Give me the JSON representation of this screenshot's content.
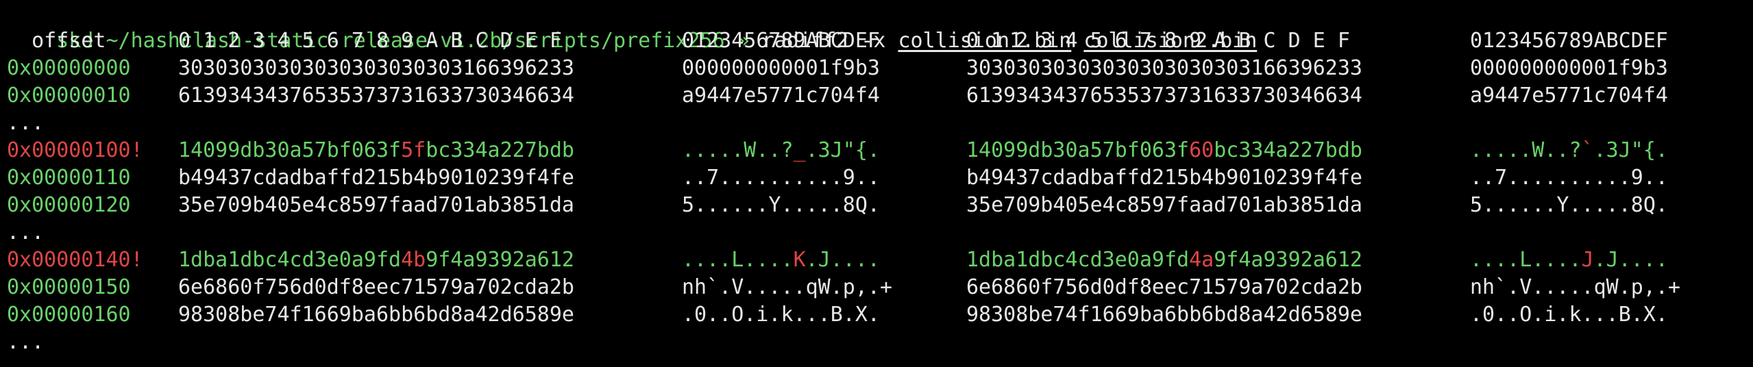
{
  "prompt": {
    "user": "skd",
    "path": "~/hashclash-static-release-v1.2b/scripts/prefix256",
    "symbol": "»",
    "command": "radiff2 -x",
    "file1": "collision1.bin",
    "file2": "collision2.bin"
  },
  "header": {
    "offset": "  offset",
    "hex": "0 1 2 3 4 5 6 7 8 9 A B C D E F",
    "ascii": "0123456789ABCDEF"
  },
  "ellipsis": "...",
  "rows": [
    {
      "offset": "0x00000000",
      "hex1": "30303030303030303030303166396233",
      "ascii1": "000000000001f9b3",
      "hex2": "30303030303030303030303166396233",
      "ascii2": "000000000001f9b3"
    },
    {
      "offset": "0x00000010",
      "hex1": "61393434376535373731633730346634",
      "ascii1": "a9447e5771c704f4",
      "hex2": "61393434376535373731633730346634",
      "ascii2": "a9447e5771c704f4"
    },
    {
      "offset": "0x00000100!",
      "hex1_pre": "14099db30a57bf063f",
      "hex1_diff": "5f",
      "hex1_post": "bc334a227bdb",
      "ascii1_pre": ".....W..?",
      "ascii1_diff": "_",
      "ascii1_post": ".3J\"{.",
      "hex2_pre": "14099db30a57bf063f",
      "hex2_diff": "60",
      "hex2_post": "bc334a227bdb",
      "ascii2_pre": ".....W..?",
      "ascii2_diff": "`",
      "ascii2_post": ".3J\"{."
    },
    {
      "offset": "0x00000110",
      "hex1": "b49437cdadbaffd215b4b9010239f4fe",
      "ascii1": "..7..........9..",
      "hex2": "b49437cdadbaffd215b4b9010239f4fe",
      "ascii2": "..7..........9.."
    },
    {
      "offset": "0x00000120",
      "hex1": "35e709b405e4c8597faad701ab3851da",
      "ascii1": "5......Y.....8Q.",
      "hex2": "35e709b405e4c8597faad701ab3851da",
      "ascii2": "5......Y.....8Q."
    },
    {
      "offset": "0x00000140!",
      "hex1_pre": "1dba1dbc4cd3e0a9fd",
      "hex1_diff": "4b",
      "hex1_post": "9f4a9392a612",
      "ascii1_pre": "....L....",
      "ascii1_diff": "K",
      "ascii1_post": ".J....",
      "hex2_pre": "1dba1dbc4cd3e0a9fd",
      "hex2_diff": "4a",
      "hex2_post": "9f4a9392a612",
      "ascii2_pre": "....L....",
      "ascii2_diff": "J",
      "ascii2_post": ".J...."
    },
    {
      "offset": "0x00000150",
      "hex1": "6e6860f756d0df8eec71579a702cda2b",
      "ascii1": "nh`.V.....qW.p,.+",
      "hex2": "6e6860f756d0df8eec71579a702cda2b",
      "ascii2": "nh`.V.....qW.p,.+"
    },
    {
      "offset": "0x00000160",
      "hex1": "98308be74f1669ba6bb6bd8a42d6589e",
      "ascii1": ".0..O.i.k...B.X.",
      "hex2": "98308be74f1669ba6bb6bd8a42d6589e",
      "ascii2": ".0..O.i.k...B.X."
    }
  ],
  "colors": {
    "background": "#000000",
    "text": "#e8e8e8",
    "green": "#6ad26a",
    "red": "#e04545"
  }
}
